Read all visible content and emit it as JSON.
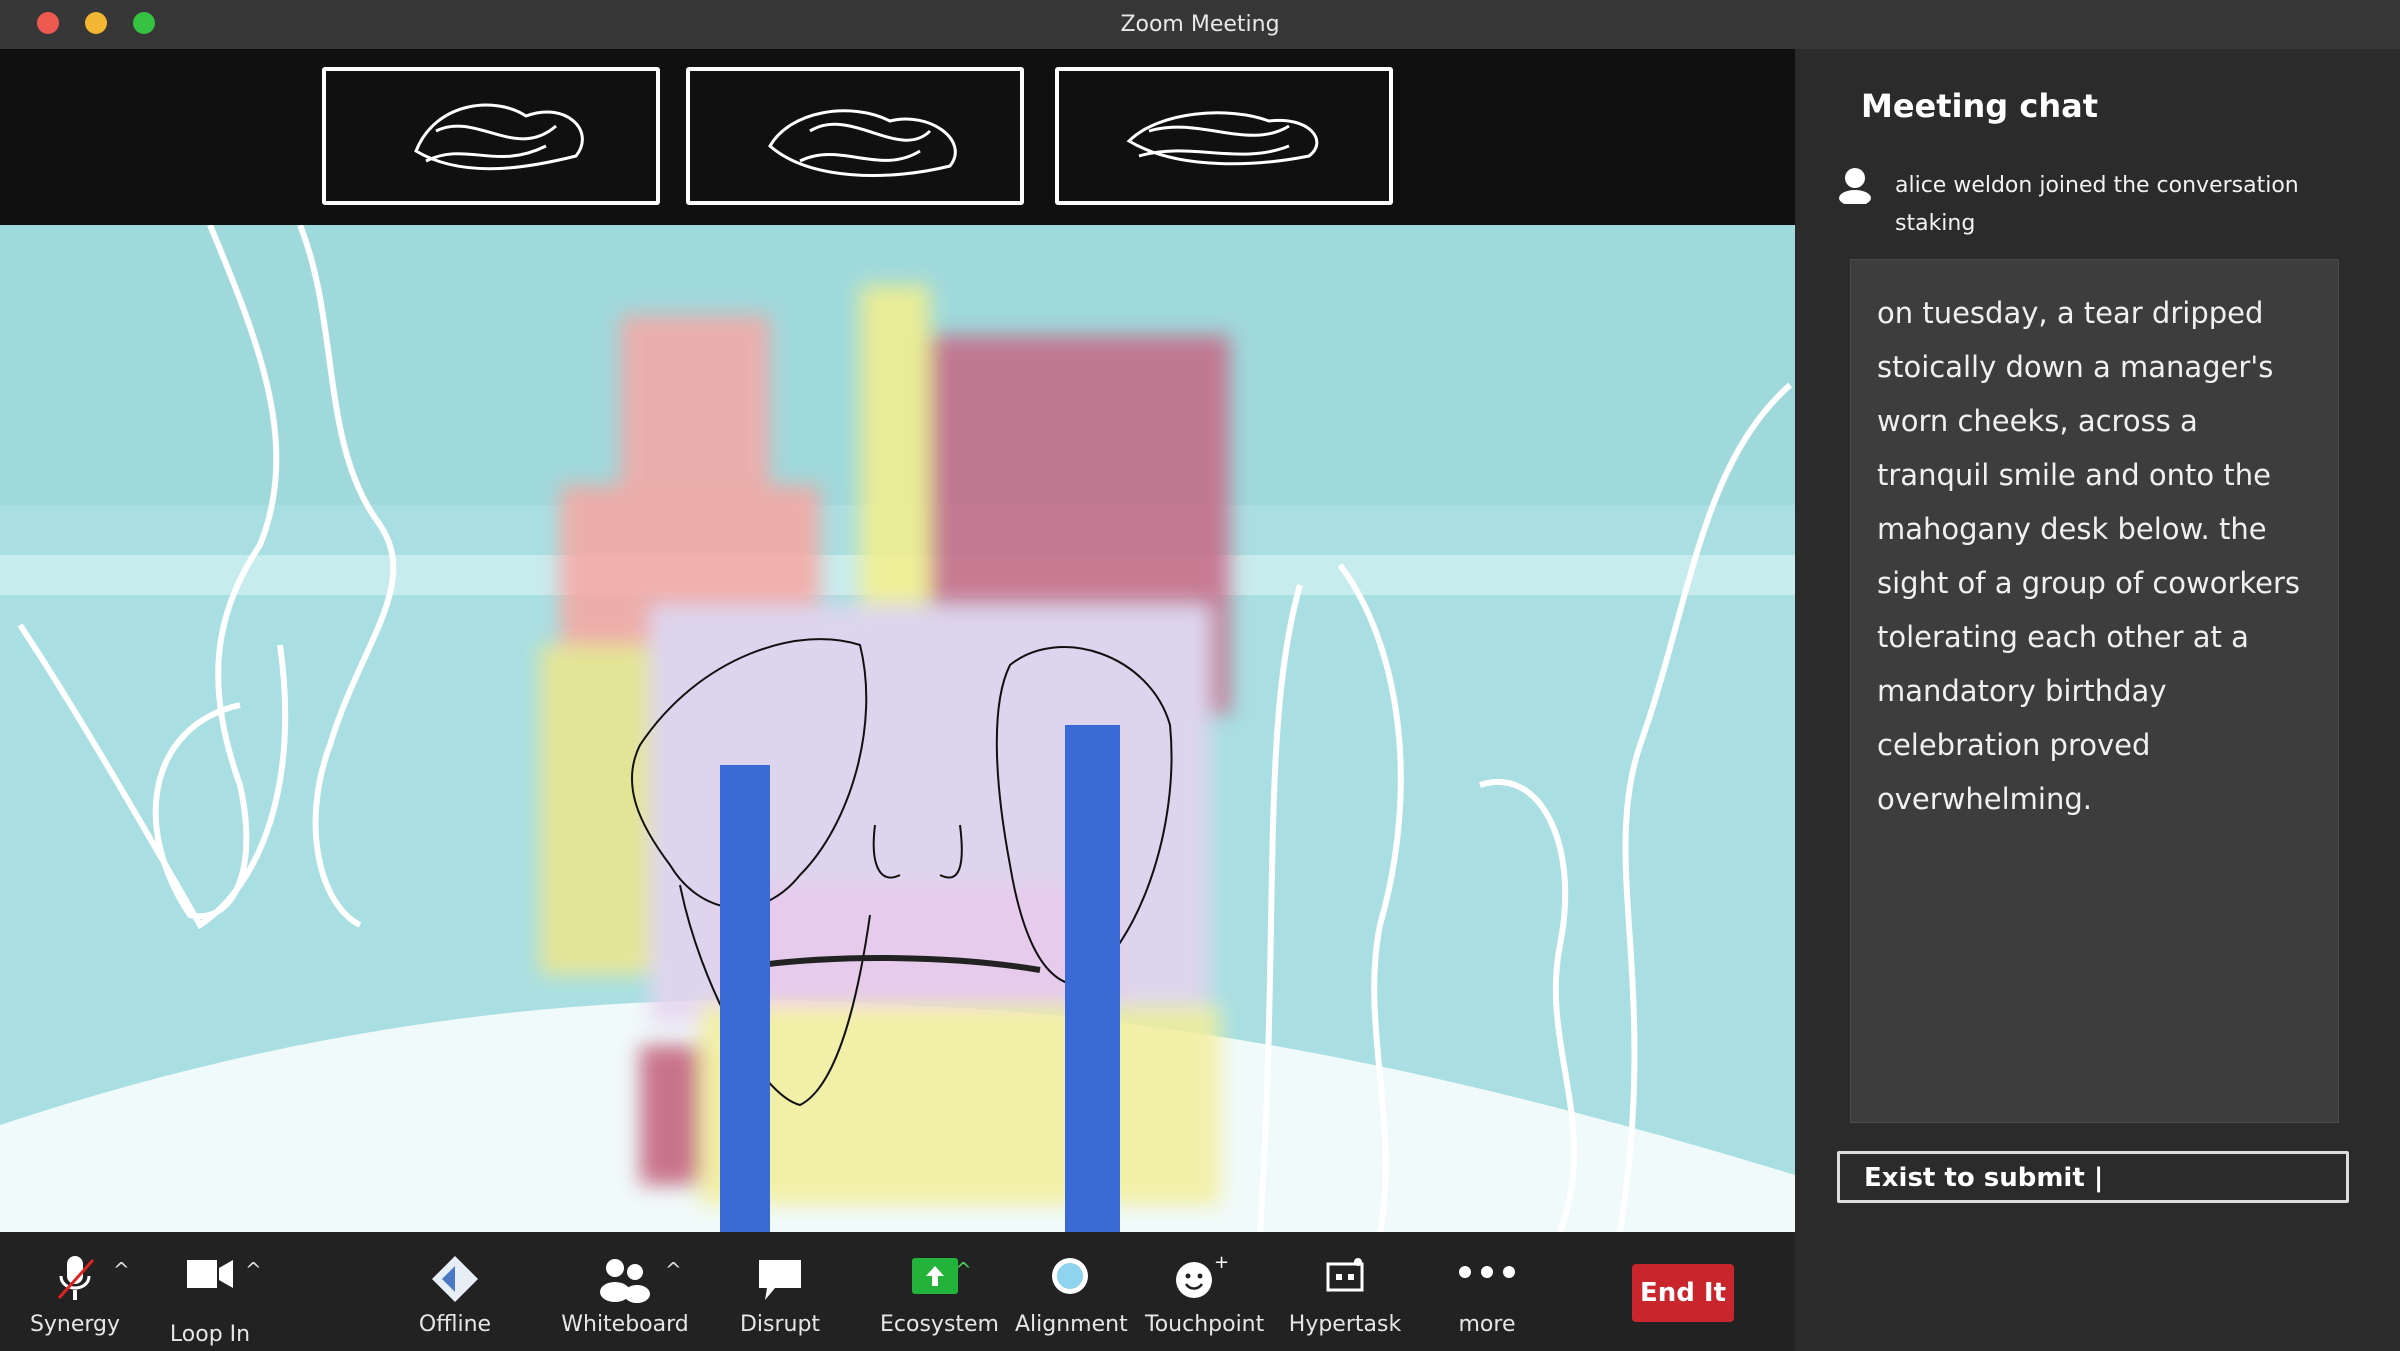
{
  "window": {
    "title": "Zoom Meeting"
  },
  "toolbar": {
    "items": [
      {
        "label": "Synergy",
        "icon": "microphone-muted-icon"
      },
      {
        "label": "Loop In",
        "icon": "video-camera-icon"
      },
      {
        "label": "Offline",
        "icon": "diamond-icon"
      },
      {
        "label": "Whiteboard",
        "icon": "participants-icon"
      },
      {
        "label": "Disrupt",
        "icon": "speech-bubble-icon"
      },
      {
        "label": "Ecosystem",
        "icon": "share-screen-icon"
      },
      {
        "label": "Alignment",
        "icon": "record-circle-icon"
      },
      {
        "label": "Touchpoint",
        "icon": "reaction-smiley-icon"
      },
      {
        "label": "Hypertask",
        "icon": "apps-icon"
      },
      {
        "label": "more",
        "icon": "more-dots-icon"
      }
    ],
    "end_label": "End It"
  },
  "chat": {
    "title": "Meeting chat",
    "join_text": "alice weldon joined the conversation staking",
    "message": "on tuesday, a tear dripped stoically down a manager's worn cheeks, across a tranquil smile and onto the mahogany desk below. the sight of a group of coworkers tolerating each other at a mandatory birthday celebration proved overwhelming.",
    "input_value": "Exist to submit |"
  },
  "colors": {
    "end_button": "#c8252d",
    "ecosystem_green": "#23b33a",
    "video_bg": "#a9dfe2"
  }
}
